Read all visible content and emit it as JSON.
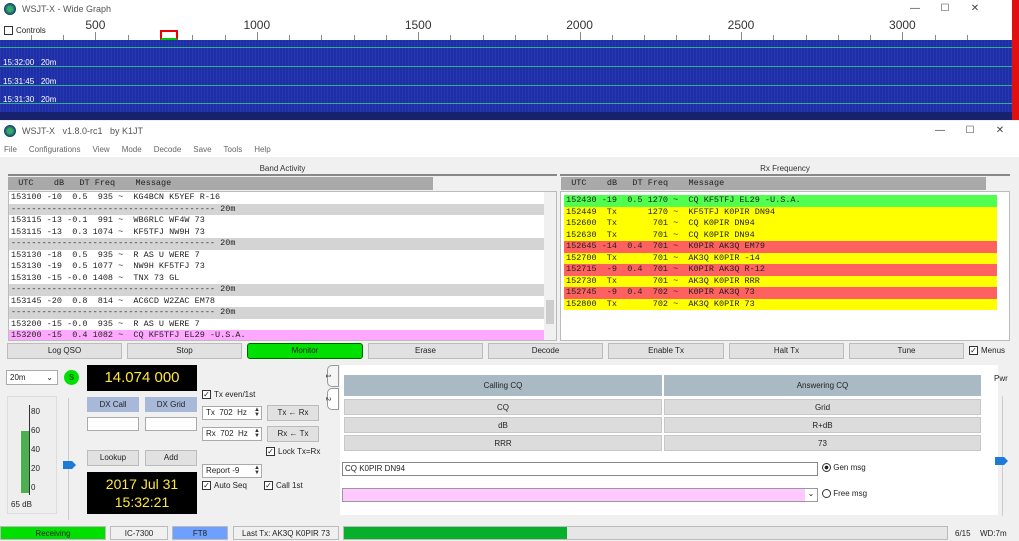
{
  "wide_graph": {
    "title": "WSJT-X - Wide Graph",
    "controls_label": "Controls",
    "controls_checked": false,
    "freq_ticks": [
      "500",
      "1000",
      "1500",
      "2000",
      "2500",
      "3000"
    ],
    "rows": [
      {
        "time": "15:32:00",
        "band": "20m"
      },
      {
        "time": "15:31:45",
        "band": "20m"
      },
      {
        "time": "15:31:30",
        "band": "20m"
      }
    ]
  },
  "main": {
    "title": "WSJT-X   v1.8.0-rc1   by K1JT",
    "menu": [
      "File",
      "Configurations",
      "View",
      "Mode",
      "Decode",
      "Save",
      "Tools",
      "Help"
    ]
  },
  "band_activity": {
    "title": "Band Activity",
    "header": "  UTC    dB   DT Freq    Message",
    "rows": [
      {
        "text": "153100 -10  0.5  935 ~  KG4BCN K5YEF R-16",
        "type": "normal"
      },
      {
        "text": "---------------------------------------- 20m",
        "type": "sep"
      },
      {
        "text": "153115 -13 -0.1  991 ~  WB6RLC WF4W 73",
        "type": "normal"
      },
      {
        "text": "153115 -13  0.3 1074 ~  KF5TFJ NW9H 73",
        "type": "normal"
      },
      {
        "text": "---------------------------------------- 20m",
        "type": "sep"
      },
      {
        "text": "153130 -18  0.5  935 ~  R AS U WERE 7",
        "type": "normal"
      },
      {
        "text": "153130 -19  0.5 1077 ~  NW9H KF5TFJ 73",
        "type": "normal"
      },
      {
        "text": "153130 -15 -0.0 1408 ~  TNX 73 GL",
        "type": "normal"
      },
      {
        "text": "---------------------------------------- 20m",
        "type": "sep"
      },
      {
        "text": "153145 -20  0.8  814 ~  AC6CD W2ZAC EM78",
        "type": "normal"
      },
      {
        "text": "---------------------------------------- 20m",
        "type": "sep"
      },
      {
        "text": "153200 -15 -0.0  935 ~  R AS U WERE 7",
        "type": "normal"
      },
      {
        "text": "153200 -15  0.4 1082 ~  CQ KF5TFJ EL29 -U.S.A.",
        "type": "cq"
      }
    ]
  },
  "rx_frequency": {
    "title": "Rx Frequency",
    "header": "  UTC    dB   DT Freq    Message",
    "rows": [
      {
        "text": "152430 -19  0.5 1270 ~  CQ KF5TFJ EL29 -U.S.A.",
        "type": "cq"
      },
      {
        "text": "152449  Tx      1270 ~  KF5TFJ K0PIR DN94",
        "type": "tx"
      },
      {
        "text": "152600  Tx       701 ~  CQ K0PIR DN94",
        "type": "tx"
      },
      {
        "text": "152630  Tx       701 ~  CQ K0PIR DN94",
        "type": "tx"
      },
      {
        "text": "152645 -14  0.4  701 ~  K0PIR AK3Q EM79",
        "type": "me"
      },
      {
        "text": "152700  Tx       701 ~  AK3Q K0PIR -14",
        "type": "tx"
      },
      {
        "text": "152715  -9  0.4  701 ~  K0PIR AK3Q R-12",
        "type": "me"
      },
      {
        "text": "152730  Tx       701 ~  AK3Q K0PIR RRR",
        "type": "tx"
      },
      {
        "text": "152745  -9  0.4  702 ~  K0PIR AK3Q 73",
        "type": "me"
      },
      {
        "text": "152800  Tx       702 ~  AK3Q K0PIR 73",
        "type": "tx"
      }
    ]
  },
  "colors": {
    "cq": "#50ff50",
    "tx": "#ffff00",
    "me": "#ff6060",
    "cq_band": "#ffa8ff",
    "monitor": "#00e000",
    "waterfall": "#1d2ea8"
  },
  "buttons": {
    "log_qso": "Log QSO",
    "stop": "Stop",
    "monitor": "Monitor",
    "erase": "Erase",
    "decode": "Decode",
    "enable_tx": "Enable Tx",
    "halt_tx": "Halt Tx",
    "tune": "Tune",
    "menus": "Menus"
  },
  "controls": {
    "band": "20m",
    "s_label": "S",
    "frequency": "14.074 000",
    "dx_call": "DX Call",
    "dx_grid": "DX Grid",
    "lookup": "Lookup",
    "add": "Add",
    "date": "2017 Jul 31",
    "time": "15:32:21",
    "meter_ticks": [
      "80",
      "60",
      "40",
      "20",
      "0"
    ],
    "meter_level_db": "65 dB",
    "meter_fraction": 0.65,
    "tx_even": "Tx even/1st",
    "tx_freq": "Tx  702  Hz",
    "rx_freq": "Rx  702  Hz",
    "tx_from_rx": "Tx ← Rx",
    "rx_from_tx": "Rx ← Tx",
    "lock": "Lock Tx=Rx",
    "report": "Report -9",
    "auto_seq": "Auto Seq",
    "call_1st": "Call 1st",
    "tab1": "1",
    "tab2": "2"
  },
  "messages": {
    "calling_cq": "Calling CQ",
    "answering_cq": "Answering CQ",
    "left": [
      "CQ",
      "dB",
      "RRR"
    ],
    "right": [
      "Grid",
      "R+dB",
      "73"
    ],
    "gen_msg_value": "CQ K0PIR DN94",
    "gen_msg": "Gen msg",
    "free_msg": "Free msg",
    "pwr": "Pwr"
  },
  "status": {
    "state": "Receiving",
    "rig": "IC-7300",
    "mode": "FT8",
    "last_tx": "Last Tx: AK3Q K0PIR 73",
    "progress_fraction": 0.37,
    "count": "6/15",
    "wd": "WD:7m"
  }
}
